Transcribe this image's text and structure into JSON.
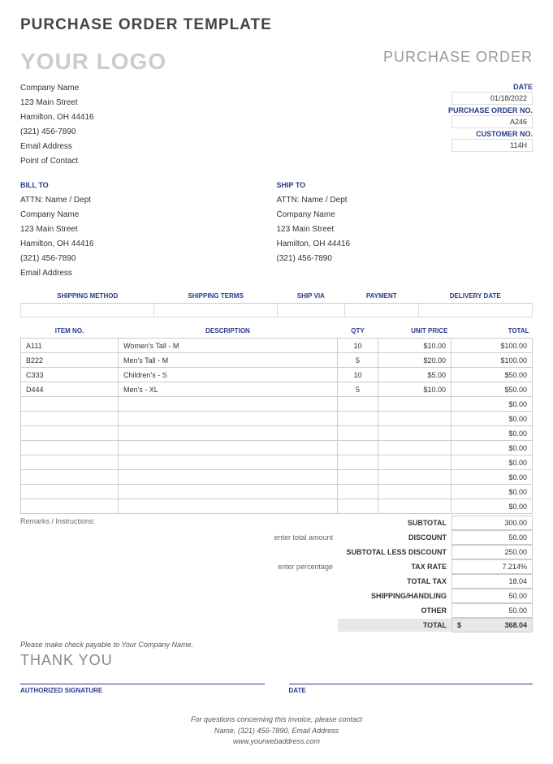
{
  "page_title": "PURCHASE ORDER TEMPLATE",
  "logo_text": "YOUR LOGO",
  "doc_type": "PURCHASE ORDER",
  "company": {
    "name": "Company Name",
    "street": "123 Main Street",
    "city": "Hamilton, OH 44416",
    "phone": "(321) 456-7890",
    "email": "Email Address",
    "contact": "Point of Contact"
  },
  "meta": {
    "date_label": "DATE",
    "date": "01/18/2022",
    "po_no_label": "PURCHASE ORDER NO.",
    "po_no": "A246",
    "cust_no_label": "CUSTOMER NO.",
    "cust_no": "114H"
  },
  "bill_to": {
    "label": "BILL TO",
    "attn": "ATTN: Name / Dept",
    "company": "Company Name",
    "street": "123 Main Street",
    "city": "Hamilton, OH 44416",
    "phone": "(321) 456-7890",
    "email": "Email Address"
  },
  "ship_to": {
    "label": "SHIP TO",
    "attn": "ATTN: Name / Dept",
    "company": "Company Name",
    "street": "123 Main Street",
    "city": "Hamilton, OH 44416",
    "phone": "(321) 456-7890"
  },
  "ship_headers": {
    "method": "SHIPPING METHOD",
    "terms": "SHIPPING TERMS",
    "via": "SHIP VIA",
    "payment": "PAYMENT",
    "delivery": "DELIVERY DATE"
  },
  "item_headers": {
    "no": "ITEM NO.",
    "desc": "DESCRIPTION",
    "qty": "QTY",
    "price": "UNIT PRICE",
    "total": "TOTAL"
  },
  "items": [
    {
      "no": "A111",
      "desc": "Women's Tall - M",
      "qty": "10",
      "price": "$10.00",
      "total": "$100.00"
    },
    {
      "no": "B222",
      "desc": "Men's Tall - M",
      "qty": "5",
      "price": "$20.00",
      "total": "$100.00"
    },
    {
      "no": "C333",
      "desc": "Children's - S",
      "qty": "10",
      "price": "$5.00",
      "total": "$50.00"
    },
    {
      "no": "D444",
      "desc": "Men's - XL",
      "qty": "5",
      "price": "$10.00",
      "total": "$50.00"
    },
    {
      "no": "",
      "desc": "",
      "qty": "",
      "price": "",
      "total": "$0.00"
    },
    {
      "no": "",
      "desc": "",
      "qty": "",
      "price": "",
      "total": "$0.00"
    },
    {
      "no": "",
      "desc": "",
      "qty": "",
      "price": "",
      "total": "$0.00"
    },
    {
      "no": "",
      "desc": "",
      "qty": "",
      "price": "",
      "total": "$0.00"
    },
    {
      "no": "",
      "desc": "",
      "qty": "",
      "price": "",
      "total": "$0.00"
    },
    {
      "no": "",
      "desc": "",
      "qty": "",
      "price": "",
      "total": "$0.00"
    },
    {
      "no": "",
      "desc": "",
      "qty": "",
      "price": "",
      "total": "$0.00"
    },
    {
      "no": "",
      "desc": "",
      "qty": "",
      "price": "",
      "total": "$0.00"
    }
  ],
  "remarks_label": "Remarks / Instructions:",
  "totals": {
    "subtotal_label": "SUBTOTAL",
    "subtotal": "300.00",
    "discount_hint": "enter total amount",
    "discount_label": "DISCOUNT",
    "discount": "50.00",
    "less_label": "SUBTOTAL LESS DISCOUNT",
    "less": "250.00",
    "tax_hint": "enter percentage",
    "tax_rate_label": "TAX RATE",
    "tax_rate": "7.214%",
    "total_tax_label": "TOTAL TAX",
    "total_tax": "18.04",
    "shipping_label": "SHIPPING/HANDLING",
    "shipping": "50.00",
    "other_label": "OTHER",
    "other": "50.00",
    "final_label": "TOTAL",
    "currency": "$",
    "final": "368.04"
  },
  "payable": "Please make check payable to Your Company Name.",
  "thanks": "THANK YOU",
  "sig": {
    "auth": "AUTHORIZED SIGNATURE",
    "date": "DATE"
  },
  "footer": {
    "line1": "For questions concerning this invoice, please contact",
    "line2": "Name, (321) 456-7890, Email Address",
    "line3": "www.yourwebaddress.com"
  }
}
